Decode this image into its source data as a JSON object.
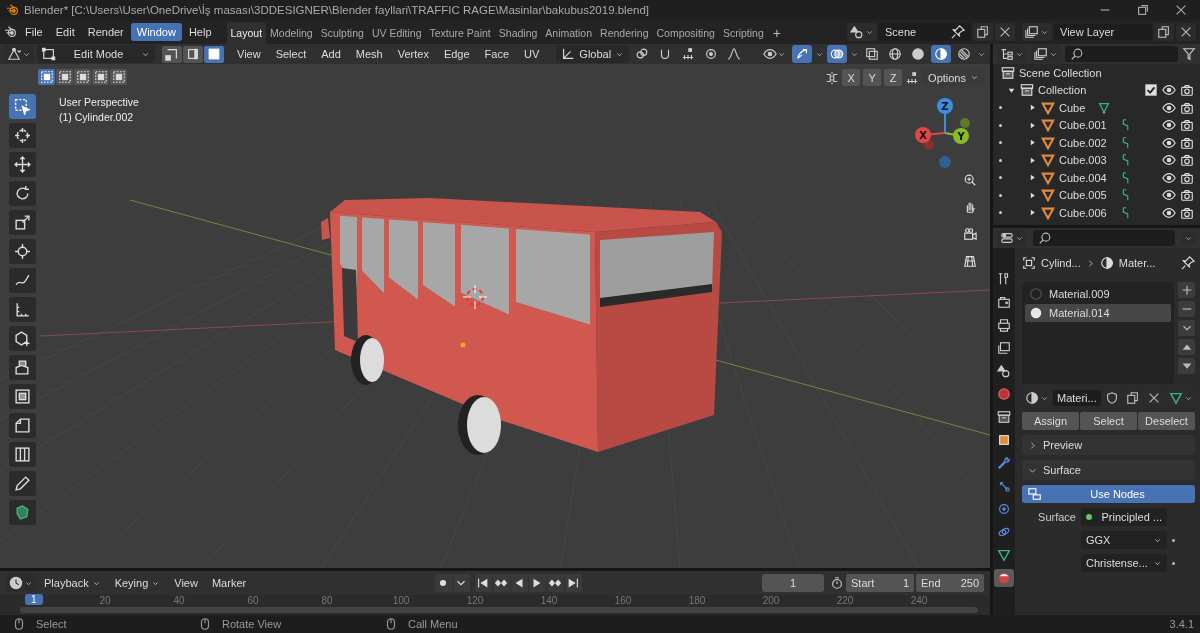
{
  "window": {
    "title": "Blender* [C:\\Users\\User\\OneDrive\\İş masası\\3DDESIGNER\\Blender fayllari\\TRAFFIC RAGE\\Masinlar\\bakubus2019.blend]"
  },
  "menu": [
    {
      "label": "File",
      "selected": false
    },
    {
      "label": "Edit",
      "selected": false
    },
    {
      "label": "Render",
      "selected": false
    },
    {
      "label": "Window",
      "selected": true
    },
    {
      "label": "Help",
      "selected": false
    }
  ],
  "workspaces": [
    {
      "label": "Layout",
      "selected": true
    },
    {
      "label": "Modeling",
      "selected": false
    },
    {
      "label": "Sculpting",
      "selected": false
    },
    {
      "label": "UV Editing",
      "selected": false
    },
    {
      "label": "Texture Paint",
      "selected": false
    },
    {
      "label": "Shading",
      "selected": false
    },
    {
      "label": "Animation",
      "selected": false
    },
    {
      "label": "Rendering",
      "selected": false
    },
    {
      "label": "Compositing",
      "selected": false
    },
    {
      "label": "Scripting",
      "selected": false
    }
  ],
  "add_workspace": "+",
  "scene": "Scene",
  "view_layer": "View Layer",
  "viewport": {
    "mode": "Edit Mode",
    "select_modes": [
      {
        "kind": "vertex",
        "selected": false
      },
      {
        "kind": "edge",
        "selected": false
      },
      {
        "kind": "face",
        "selected": true
      }
    ],
    "menus": [
      "View",
      "Select",
      "Add",
      "Mesh",
      "Vertex",
      "Edge",
      "Face",
      "UV"
    ],
    "orientation": "Global",
    "toggles": [
      {
        "kind": "gizmo",
        "selected": true
      },
      {
        "kind": "overlay",
        "selected": true
      },
      {
        "kind": "xray",
        "selected": false
      }
    ],
    "shading": [
      {
        "kind": "wireframe",
        "selected": false
      },
      {
        "kind": "solid",
        "selected": false
      },
      {
        "kind": "material",
        "selected": true
      },
      {
        "kind": "rendered",
        "selected": false
      }
    ],
    "selection_sets": [
      {
        "selected": true
      },
      {
        "selected": false
      },
      {
        "selected": false
      },
      {
        "selected": false
      },
      {
        "selected": false
      }
    ],
    "mirror_axes": [
      {
        "label": "X",
        "selected": false
      },
      {
        "label": "Y",
        "selected": false
      },
      {
        "label": "Z",
        "selected": false
      }
    ],
    "options": "Options",
    "info": [
      "User Perspective",
      "(1) Cylinder.002"
    ],
    "gizmo_axes": [
      "X",
      "Y",
      "Z"
    ],
    "tools": [
      {
        "kind": "select-box",
        "selected": true
      },
      {
        "kind": "cursor",
        "selected": false
      },
      {
        "kind": "move",
        "selected": false
      },
      {
        "kind": "rotate",
        "selected": false
      },
      {
        "kind": "scale",
        "selected": false
      },
      {
        "kind": "transform",
        "selected": false
      },
      {
        "kind": "annotate",
        "selected": false
      },
      {
        "kind": "measure",
        "selected": false
      },
      {
        "kind": "add-cube",
        "selected": false
      },
      {
        "kind": "extrude",
        "selected": false
      },
      {
        "kind": "inset",
        "selected": false
      },
      {
        "kind": "bevel",
        "selected": false
      },
      {
        "kind": "loop-cut",
        "selected": false
      },
      {
        "kind": "knife",
        "selected": false
      },
      {
        "kind": "poly-build",
        "selected": false
      }
    ]
  },
  "outliner": {
    "root": "Scene Collection",
    "collection": {
      "name": "Collection",
      "expanded": true,
      "checked": true,
      "children": [
        {
          "name": "Cube",
          "expanded": false,
          "kind": "mesh"
        },
        {
          "name": "Cube.001",
          "expanded": false,
          "kind": "hook"
        },
        {
          "name": "Cube.002",
          "expanded": false,
          "kind": "hook"
        },
        {
          "name": "Cube.003",
          "expanded": false,
          "kind": "hook"
        },
        {
          "name": "Cube.004",
          "expanded": false,
          "kind": "hook"
        },
        {
          "name": "Cube.005",
          "expanded": false,
          "kind": "hook"
        },
        {
          "name": "Cube.006",
          "expanded": false,
          "kind": "hook"
        }
      ]
    }
  },
  "properties": {
    "tabs": [
      {
        "kind": "tool",
        "selected": false
      },
      {
        "kind": "render",
        "selected": false
      },
      {
        "kind": "output",
        "selected": false
      },
      {
        "kind": "view_layer",
        "selected": false
      },
      {
        "kind": "scene",
        "selected": false
      },
      {
        "kind": "world",
        "selected": false
      },
      {
        "kind": "collection",
        "selected": false
      },
      {
        "kind": "object",
        "selected": false
      },
      {
        "kind": "modifiers",
        "selected": false
      },
      {
        "kind": "particles",
        "selected": false
      },
      {
        "kind": "physics",
        "selected": false
      },
      {
        "kind": "constraints",
        "selected": false
      },
      {
        "kind": "data",
        "selected": false
      },
      {
        "kind": "material",
        "selected": true
      }
    ],
    "breadcrumb": [
      "Cylind...",
      "Mater..."
    ],
    "slots": [
      {
        "name": "Material.009",
        "selected": false
      },
      {
        "name": "Material.014",
        "selected": true
      }
    ],
    "material": "Materi...",
    "buttons": [
      "Assign",
      "Select",
      "Deselect"
    ],
    "panels": [
      {
        "label": "Preview",
        "expanded": false
      },
      {
        "label": "Surface",
        "expanded": true
      }
    ],
    "use_nodes": "Use Nodes",
    "surface": {
      "label": "Surface",
      "value": "Principled ..."
    },
    "dropdowns": [
      "GGX",
      "Christense..."
    ]
  },
  "timeline": {
    "menus": [
      {
        "label": "Playback",
        "dropdown": true
      },
      {
        "label": "Keying",
        "dropdown": true
      },
      {
        "label": "View",
        "dropdown": false
      },
      {
        "label": "Marker",
        "dropdown": false
      }
    ],
    "current_frame": "1",
    "start": {
      "label": "Start",
      "value": "1"
    },
    "end": {
      "label": "End",
      "value": "250"
    },
    "playhead": "1",
    "ticks": [
      "20",
      "40",
      "60",
      "80",
      "100",
      "120",
      "140",
      "160",
      "180",
      "200",
      "220",
      "240"
    ]
  },
  "status_bar": {
    "hints": [
      "Select",
      "Rotate View",
      "Call Menu"
    ],
    "version": "3.4.1"
  }
}
